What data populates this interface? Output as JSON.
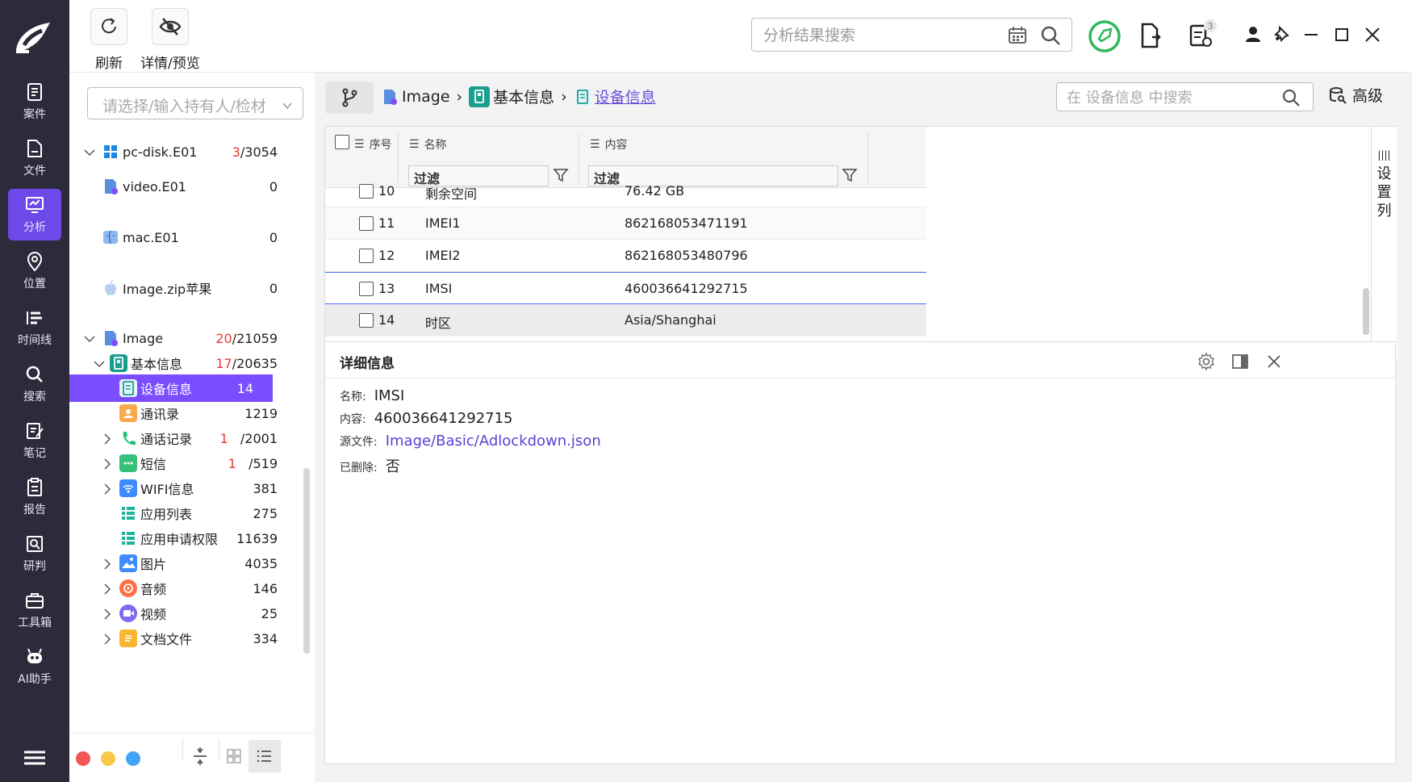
{
  "nav": {
    "items": [
      {
        "label": "案件",
        "icon": "case-icon"
      },
      {
        "label": "文件",
        "icon": "file-icon"
      },
      {
        "label": "分析",
        "icon": "analysis-icon",
        "active": true
      },
      {
        "label": "位置",
        "icon": "location-icon"
      },
      {
        "label": "时间线",
        "icon": "timeline-icon"
      },
      {
        "label": "搜索",
        "icon": "search-icon"
      },
      {
        "label": "笔记",
        "icon": "note-icon"
      },
      {
        "label": "报告",
        "icon": "report-icon"
      },
      {
        "label": "研判",
        "icon": "judge-icon"
      },
      {
        "label": "工具箱",
        "icon": "toolbox-icon"
      },
      {
        "label": "AI助手",
        "icon": "ai-robot-icon"
      }
    ]
  },
  "toolbar": {
    "refresh_label": "刷新",
    "detail_preview_label": "详情/预览"
  },
  "search": {
    "placeholder": "分析结果搜索"
  },
  "window": {
    "task_badge": "3"
  },
  "sidebar": {
    "owner_placeholder": "请选择/输入持有人/检材",
    "tree": [
      {
        "label": "pc-disk.E01",
        "hl": "3",
        "count": "/3054"
      },
      {
        "label": "video.E01",
        "hl": "",
        "count": "0"
      },
      {
        "label": "mac.E01",
        "hl": "",
        "count": "0"
      },
      {
        "label": "Image.zip苹果",
        "hl": "",
        "count": "0"
      },
      {
        "label": "Image",
        "hl": "20",
        "count": "/21059"
      },
      {
        "label": "基本信息",
        "hl": "17",
        "count": "/20635"
      },
      {
        "label": "设备信息",
        "hl": "",
        "count": "14"
      },
      {
        "label": "通讯录",
        "hl": "",
        "count": "1219"
      },
      {
        "label": "通话记录",
        "hl": "1",
        "count": "/2001"
      },
      {
        "label": "短信",
        "hl": "1",
        "count": "/519"
      },
      {
        "label": "WIFI信息",
        "hl": "",
        "count": "381"
      },
      {
        "label": "应用列表",
        "hl": "",
        "count": "275"
      },
      {
        "label": "应用申请权限",
        "hl": "",
        "count": "11639"
      },
      {
        "label": "图片",
        "hl": "",
        "count": "4035"
      },
      {
        "label": "音频",
        "hl": "",
        "count": "146"
      },
      {
        "label": "视频",
        "hl": "",
        "count": "25"
      },
      {
        "label": "文档文件",
        "hl": "",
        "count": "334"
      }
    ]
  },
  "breadcrumb": {
    "items": [
      "Image",
      "基本信息",
      "设备信息"
    ]
  },
  "table_search": {
    "placeholder": "在 设备信息 中搜索"
  },
  "advanced_label": "高级",
  "table": {
    "columns": [
      "序号",
      "名称",
      "内容"
    ],
    "filter_placeholder": "过滤",
    "rows": [
      {
        "num": "10",
        "name": "剩余空间",
        "value": "76.42 GB"
      },
      {
        "num": "11",
        "name": "IMEI1",
        "value": "862168053471191"
      },
      {
        "num": "12",
        "name": "IMEI2",
        "value": "862168053480796"
      },
      {
        "num": "13",
        "name": "IMSI",
        "value": "460036641292715"
      },
      {
        "num": "14",
        "name": "时区",
        "value": "Asia/Shanghai"
      }
    ],
    "settings_label": "设置列"
  },
  "detail": {
    "title": "详细信息",
    "fields": [
      {
        "key": "名称:",
        "value": "IMSI"
      },
      {
        "key": "内容:",
        "value": "460036641292715"
      },
      {
        "key": "源文件:",
        "value": "Image/Basic/Adlockdown.json"
      },
      {
        "key": "已删除:",
        "value": "否"
      }
    ]
  },
  "colors": {
    "nav_bg": "#2b2b3c",
    "accent": "#7c4dff",
    "highlight_count": "#e53935",
    "link": "#5b3fd6"
  }
}
